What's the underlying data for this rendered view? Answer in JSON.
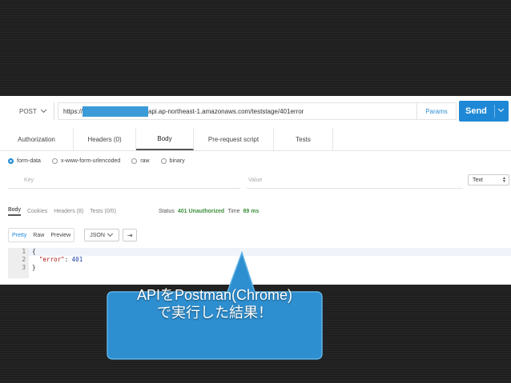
{
  "request": {
    "method": "POST",
    "url_prefix": "https://",
    "url_suffix": "api.ap-northeast-1.amazonaws.com/teststage/401error",
    "params_label": "Params",
    "send_label": "Send"
  },
  "request_tabs": [
    "Authorization",
    "Headers (0)",
    "Body",
    "Pre-request script",
    "Tests"
  ],
  "body_types": [
    "form-data",
    "x-www-form-urlencoded",
    "raw",
    "binary"
  ],
  "kv": {
    "key_placeholder": "Key",
    "value_placeholder": "Value",
    "type_select": "Text"
  },
  "response_tabs": [
    "Body",
    "Cookies",
    "Headers (8)",
    "Tests (0/0)"
  ],
  "status": {
    "status_label": "Status",
    "status_value": "401 Unauthorized",
    "time_label": "Time",
    "time_value": "89 ms"
  },
  "view": {
    "modes": [
      "Pretty",
      "Raw",
      "Preview"
    ],
    "format": "JSON",
    "wrap_icon": "wrap-lines-icon"
  },
  "code": {
    "line_numbers": [
      "1",
      "2",
      "3"
    ],
    "open": "{",
    "key": "\"error\"",
    "sep": ": ",
    "value": "401",
    "close": "}"
  },
  "callout": {
    "line1": "APIをPostman(Chrome)",
    "line2": "で実行した結果！"
  },
  "colors": {
    "accent": "#1f88d6",
    "status_ok": "#3c8f3c",
    "callout_fill": "#2e8fd0",
    "background": "#1f1f1f"
  }
}
